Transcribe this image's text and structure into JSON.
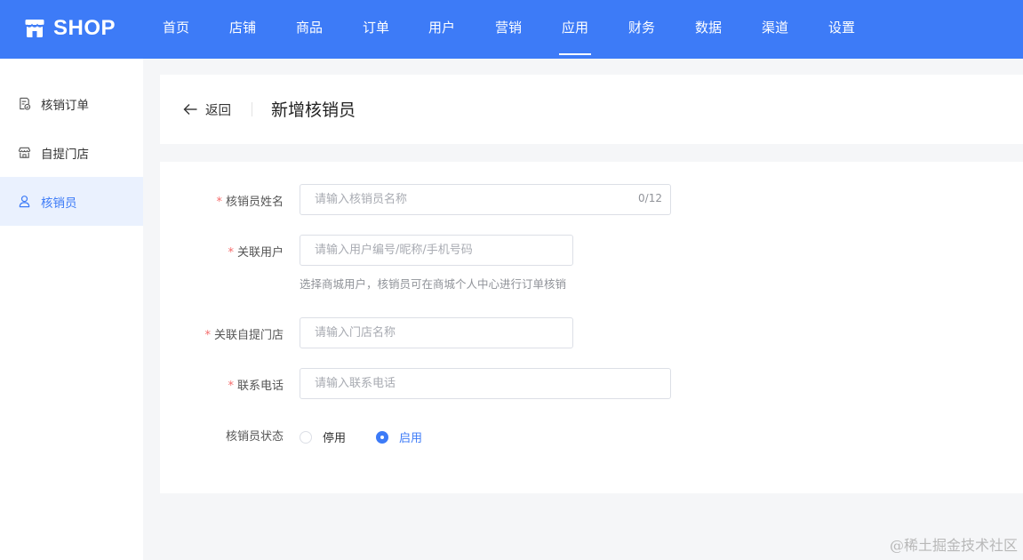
{
  "app": {
    "name": "SHOP"
  },
  "nav": {
    "items": [
      "首页",
      "店铺",
      "商品",
      "订单",
      "用户",
      "营销",
      "应用",
      "财务",
      "数据",
      "渠道",
      "设置"
    ],
    "active": "应用"
  },
  "sidebar": {
    "items": [
      {
        "label": "核销订单",
        "icon": "order-check-icon"
      },
      {
        "label": "自提门店",
        "icon": "store-icon"
      },
      {
        "label": "核销员",
        "icon": "user-icon"
      }
    ],
    "active": "核销员"
  },
  "header": {
    "back_label": "返回",
    "title": "新增核销员"
  },
  "form": {
    "name": {
      "label": "核销员姓名",
      "placeholder": "请输入核销员名称",
      "value": "",
      "counter": "0/12",
      "required": "*"
    },
    "user": {
      "label": "关联用户",
      "placeholder": "请输入用户编号/昵称/手机号码",
      "value": "",
      "help": "选择商城用户，核销员可在商城个人中心进行订单核销",
      "required": "*"
    },
    "store": {
      "label": "关联自提门店",
      "placeholder": "请输入门店名称",
      "value": "",
      "required": "*"
    },
    "phone": {
      "label": "联系电话",
      "placeholder": "请输入联系电话",
      "value": "",
      "required": "*"
    },
    "status": {
      "label": "核销员状态",
      "options": [
        "停用",
        "启用"
      ],
      "selected": "启用"
    }
  },
  "watermark": "@稀土掘金技术社区",
  "colors": {
    "primary": "#3d7bf7",
    "required": "#f56c6c",
    "background": "#f5f6f8"
  }
}
